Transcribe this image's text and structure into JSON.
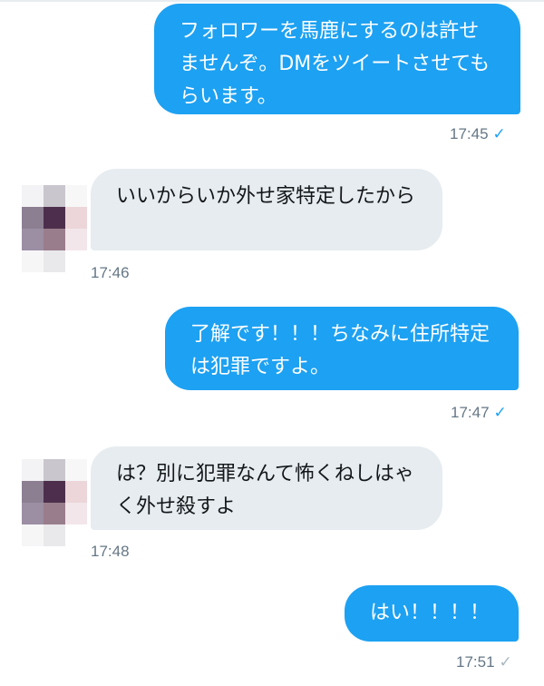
{
  "conversation": {
    "messages": [
      {
        "side": "sent",
        "text": "フォロワーを馬鹿にするのは許せませんぞ。DMをツイートさせてもらいます。",
        "time": "17:45",
        "read": true
      },
      {
        "side": "received",
        "text": "いいからいか外せ家特定したから",
        "time": "17:46"
      },
      {
        "side": "sent",
        "text": "了解です！！！ちなみに住所特定は犯罪ですよ。",
        "time": "17:47",
        "read": true
      },
      {
        "side": "received",
        "text": "は？別に犯罪なんて怖くねしはゃく外せ殺すよ",
        "time": "17:48"
      },
      {
        "side": "sent",
        "text": "はい！！！！",
        "time": "17:51",
        "read": false
      }
    ],
    "check_glyph": "✓"
  },
  "colors": {
    "sent_bubble": "#1da1f2",
    "received_bubble": "#e6ecf0",
    "timestamp": "#657786",
    "read_check": "#1da1f2",
    "unread_check": "#aab8c2"
  },
  "avatar": {
    "icon": "pixelated-avatar-icon",
    "pixels": [
      [
        "#f3f2f4",
        "#c9c6cd",
        "#f7f7f8"
      ],
      [
        "#8c7f92",
        "#4d2f4d",
        "#ecd6d9"
      ],
      [
        "#9c8ea3",
        "#9a7d8c",
        "#f3e6ea"
      ],
      [
        "#f6f6f7",
        "#e9e8eb",
        "#ffffff"
      ]
    ]
  }
}
